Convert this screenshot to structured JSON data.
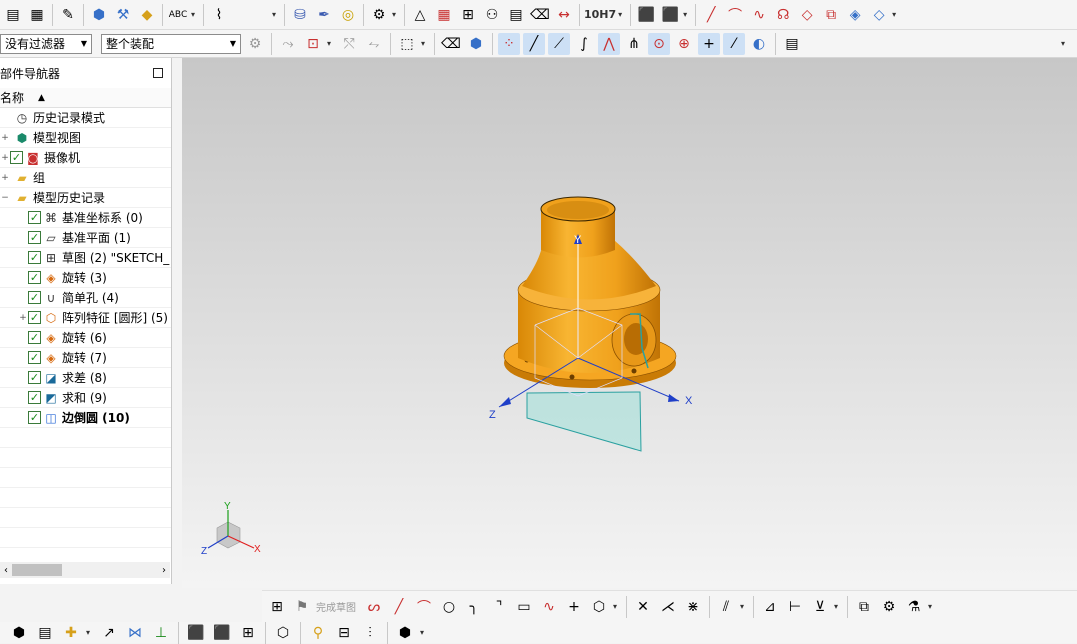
{
  "toolbar_top": {
    "tolerance_label": "10H7"
  },
  "selection_bar": {
    "filter_value": "没有过滤器",
    "scope_value": "整个装配"
  },
  "navigator": {
    "title": "部件导航器",
    "column_name": "名称",
    "items": [
      {
        "label": "历史记录模式",
        "icon": "clock-icon",
        "expander": "",
        "checked": false,
        "bold": false,
        "indent": 1
      },
      {
        "label": "模型视图",
        "icon": "model-view-icon",
        "expander": "+",
        "checked": false,
        "bold": false,
        "indent": 1
      },
      {
        "label": "摄像机",
        "icon": "camera-icon",
        "expander": "+",
        "checked": true,
        "bold": false,
        "indent": 1
      },
      {
        "label": "组",
        "icon": "folder-icon",
        "expander": "+",
        "checked": false,
        "bold": false,
        "indent": 1
      },
      {
        "label": "模型历史记录",
        "icon": "folder-icon",
        "expander": "−",
        "checked": false,
        "bold": false,
        "indent": 1
      },
      {
        "label": "基准坐标系 (0)",
        "icon": "datum-csys-icon",
        "expander": "",
        "checked": true,
        "bold": false,
        "indent": 2
      },
      {
        "label": "基准平面 (1)",
        "icon": "datum-plane-icon",
        "expander": "",
        "checked": true,
        "bold": false,
        "indent": 2
      },
      {
        "label": "草图 (2) \"SKETCH_",
        "icon": "sketch-icon",
        "expander": "",
        "checked": true,
        "bold": false,
        "indent": 2
      },
      {
        "label": "旋转 (3)",
        "icon": "revolve-icon",
        "expander": "",
        "checked": true,
        "bold": false,
        "indent": 2
      },
      {
        "label": "简单孔 (4)",
        "icon": "hole-icon",
        "expander": "",
        "checked": true,
        "bold": false,
        "indent": 2
      },
      {
        "label": "阵列特征 [圆形] (5)",
        "icon": "pattern-icon",
        "expander": "+",
        "checked": true,
        "bold": false,
        "indent": 2
      },
      {
        "label": "旋转 (6)",
        "icon": "revolve-icon",
        "expander": "",
        "checked": true,
        "bold": false,
        "indent": 2
      },
      {
        "label": "旋转 (7)",
        "icon": "revolve-icon",
        "expander": "",
        "checked": true,
        "bold": false,
        "indent": 2
      },
      {
        "label": "求差 (8)",
        "icon": "subtract-icon",
        "expander": "",
        "checked": true,
        "bold": false,
        "indent": 2
      },
      {
        "label": "求和 (9)",
        "icon": "unite-icon",
        "expander": "",
        "checked": true,
        "bold": false,
        "indent": 2
      },
      {
        "label": "边倒圆 (10)",
        "icon": "edge-blend-icon",
        "expander": "",
        "checked": true,
        "bold": true,
        "indent": 2
      }
    ]
  },
  "viewport": {
    "axis_x": "X",
    "axis_y": "Y",
    "axis_z": "Z",
    "triad_x": "X",
    "triad_y": "Y",
    "triad_z": "Z"
  },
  "sketch_toolbar": {
    "finish_label": "完成草图"
  },
  "colors": {
    "part_orange": "#f0a11c",
    "part_dark": "#c97b06",
    "plane_teal": "#2aa0a0",
    "axis_blue": "#1f3fc8"
  }
}
